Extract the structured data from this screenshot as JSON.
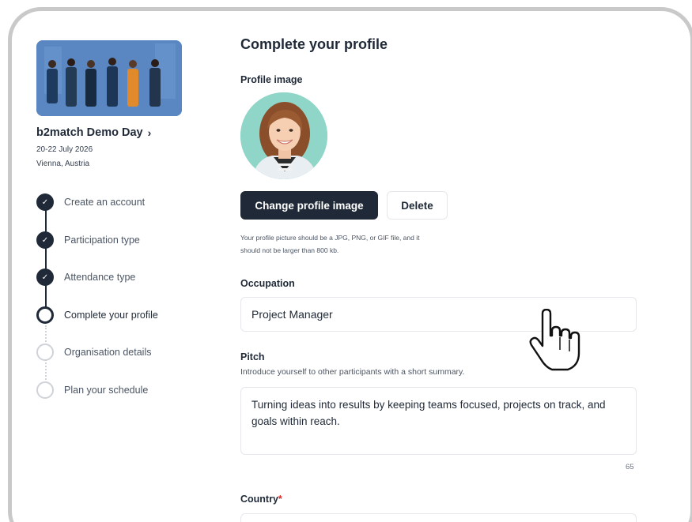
{
  "event": {
    "name": "b2match Demo Day",
    "dates": "20-22 July 2026",
    "location": "Vienna, Austria"
  },
  "steps": [
    {
      "label": "Create an account",
      "state": "done"
    },
    {
      "label": "Participation type",
      "state": "done"
    },
    {
      "label": "Attendance type",
      "state": "done"
    },
    {
      "label": "Complete your profile",
      "state": "current"
    },
    {
      "label": "Organisation details",
      "state": "todo"
    },
    {
      "label": "Plan your schedule",
      "state": "todo"
    }
  ],
  "main": {
    "title": "Complete your profile",
    "profile_image_label": "Profile image",
    "change_image_button": "Change profile image",
    "delete_button": "Delete",
    "image_helper_line1": "Your profile picture should be a JPG, PNG, or GIF file, and it",
    "image_helper_line2": "should not be larger than 800 kb.",
    "occupation_label": "Occupation",
    "occupation_value": "Project Manager",
    "pitch_label": "Pitch",
    "pitch_description": "Introduce yourself to other participants with a short summary.",
    "pitch_value": "Turning ideas into results by keeping teams focused, projects on track, and goals within reach.",
    "pitch_counter": "65",
    "country_label": "Country",
    "country_required_mark": "*"
  },
  "icons": {
    "check": "check-icon",
    "chevron": "chevron-right-icon",
    "cursor": "hand-pointer-icon"
  },
  "colors": {
    "primary": "#1f2937",
    "avatar_bg": "#8fd6c9",
    "required": "#dc2626"
  }
}
